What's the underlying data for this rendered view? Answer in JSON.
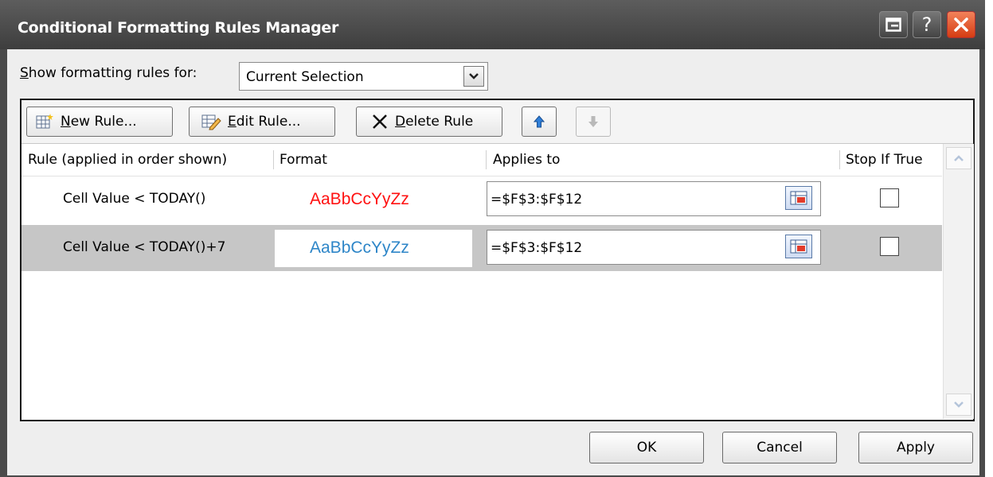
{
  "window": {
    "title": "Conditional Formatting Rules Manager"
  },
  "show_rules": {
    "label": "Show formatting rules for:",
    "selected": "Current Selection"
  },
  "toolbar": {
    "new_rule_label": "New Rule...",
    "edit_rule_label": "Edit Rule...",
    "delete_rule_label": "Delete Rule"
  },
  "columns": {
    "rule": "Rule (applied in order shown)",
    "format": "Format",
    "applies_to": "Applies to",
    "stop_if_true": "Stop If True"
  },
  "rules": [
    {
      "rule": "Cell Value < TODAY()",
      "format_preview": "AaBbCcYyZz",
      "format_color": "#ff1111",
      "applies_to": "=$F$3:$F$12",
      "stop_if_true": false
    },
    {
      "rule": "Cell Value < TODAY()+7",
      "format_preview": "AaBbCcYyZz",
      "format_color": "#2e86c8",
      "applies_to": "=$F$3:$F$12",
      "stop_if_true": false,
      "selected": true
    }
  ],
  "buttons": {
    "ok": "OK",
    "cancel": "Cancel",
    "apply": "Apply"
  },
  "icons": {
    "new_rule": "new-rule-icon",
    "edit_rule": "edit-rule-icon",
    "delete_rule": "delete-x-icon",
    "move_up": "arrow-up-icon",
    "move_down": "arrow-down-icon",
    "range_picker": "range-select-icon"
  }
}
